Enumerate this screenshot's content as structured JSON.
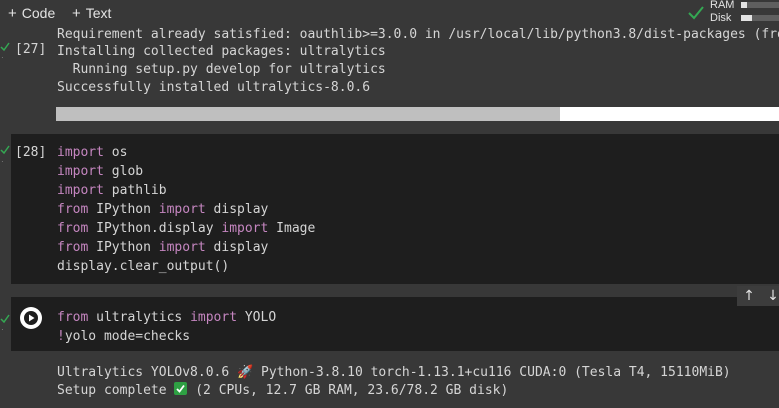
{
  "toolbar": {
    "code_label": "Code",
    "text_label": "Text"
  },
  "resources": {
    "ram_label": "RAM",
    "disk_label": "Disk",
    "ram_fraction": 0.15,
    "disk_fraction": 0.3
  },
  "cells": [
    {
      "exec_label": "[27]",
      "output_lines": [
        "Requirement already satisfied: oauthlib>=3.0.0 in /usr/local/lib/python3.8/dist-packages (from",
        "Installing collected packages: ultralytics",
        "  Running setup.py develop for ultralytics",
        "Successfully installed ultralytics-8.0.6"
      ]
    },
    {
      "exec_label": "[28]",
      "code_lines": [
        {
          "kw1": "import",
          "rest1": " os",
          "kw2": "",
          "rest2": ""
        },
        {
          "kw1": "import",
          "rest1": " glob",
          "kw2": "",
          "rest2": ""
        },
        {
          "kw1": "import",
          "rest1": " pathlib",
          "kw2": "",
          "rest2": ""
        },
        {
          "kw1": "from",
          "rest1": " IPython ",
          "kw2": "import",
          "rest2": " display"
        },
        {
          "kw1": "from",
          "rest1": " IPython.display ",
          "kw2": "import",
          "rest2": " Image"
        },
        {
          "kw1": "from",
          "rest1": " IPython ",
          "kw2": "import",
          "rest2": " display"
        },
        {
          "kw1": "",
          "rest1": "display.clear_output()",
          "kw2": "",
          "rest2": ""
        }
      ]
    },
    {
      "code_lines": [
        {
          "kw1": "from",
          "rest1": " ultralytics ",
          "kw2": "import",
          "rest2": " YOLO"
        },
        {
          "kw1": "!",
          "rest1": "yolo mode=checks",
          "kw2": "",
          "rest2": ""
        }
      ],
      "output_line1": "Ultralytics YOLOv8.0.6 🚀 Python-3.8.10 torch-1.13.1+cu116 CUDA:0 (Tesla T4, 15110MiB)",
      "output_line2_pre": "Setup complete",
      "output_line2_post": " (2 CPUs, 12.7 GB RAM, 23.6/78.2 GB disk)"
    }
  ],
  "colors": {
    "keyword": "#c586c0",
    "background": "#383838",
    "code_bg": "#1e1e1e",
    "check": "#2ea043"
  }
}
